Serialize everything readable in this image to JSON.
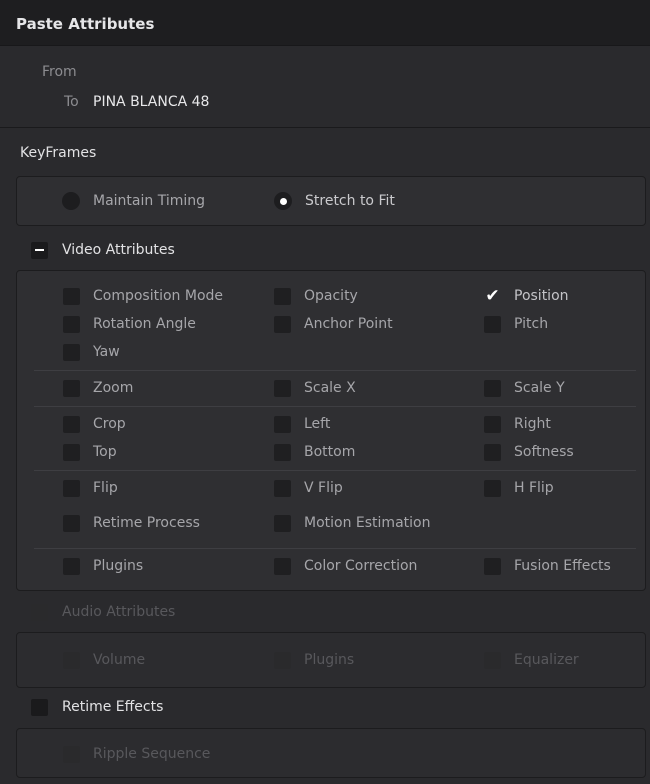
{
  "dialog": {
    "title": "Paste Attributes",
    "from_label": "From",
    "to_label": "To",
    "to_value": "PINA BLANCA 48"
  },
  "keyframes": {
    "title": "KeyFrames",
    "options": [
      {
        "label": "Maintain Timing",
        "selected": false
      },
      {
        "label": "Stretch to Fit",
        "selected": true
      }
    ]
  },
  "video_attributes": {
    "title": "Video Attributes",
    "state": "partial",
    "items": {
      "composition_mode": {
        "label": "Composition Mode",
        "checked": false
      },
      "opacity": {
        "label": "Opacity",
        "checked": false
      },
      "position": {
        "label": "Position",
        "checked": true
      },
      "rotation_angle": {
        "label": "Rotation Angle",
        "checked": false
      },
      "anchor_point": {
        "label": "Anchor Point",
        "checked": false
      },
      "pitch": {
        "label": "Pitch",
        "checked": false
      },
      "yaw": {
        "label": "Yaw",
        "checked": false
      },
      "zoom": {
        "label": "Zoom",
        "checked": false
      },
      "scale_x": {
        "label": "Scale X",
        "checked": false
      },
      "scale_y": {
        "label": "Scale Y",
        "checked": false
      },
      "crop": {
        "label": "Crop",
        "checked": false
      },
      "left": {
        "label": "Left",
        "checked": false
      },
      "right": {
        "label": "Right",
        "checked": false
      },
      "top": {
        "label": "Top",
        "checked": false
      },
      "bottom": {
        "label": "Bottom",
        "checked": false
      },
      "softness": {
        "label": "Softness",
        "checked": false
      },
      "flip": {
        "label": "Flip",
        "checked": false
      },
      "v_flip": {
        "label": "V Flip",
        "checked": false
      },
      "h_flip": {
        "label": "H Flip",
        "checked": false
      },
      "retime_process": {
        "label": "Retime Process",
        "checked": false
      },
      "motion_estimation": {
        "label": "Motion Estimation",
        "checked": false
      },
      "plugins": {
        "label": "Plugins",
        "checked": false
      },
      "color_correction": {
        "label": "Color Correction",
        "checked": false
      },
      "fusion_effects": {
        "label": "Fusion Effects",
        "checked": false
      }
    }
  },
  "audio_attributes": {
    "title": "Audio Attributes",
    "enabled": false,
    "items": {
      "volume": {
        "label": "Volume",
        "checked": false
      },
      "plugins": {
        "label": "Plugins",
        "checked": false
      },
      "equalizer": {
        "label": "Equalizer",
        "checked": false
      }
    }
  },
  "retime_effects": {
    "title": "Retime Effects",
    "checked": false,
    "items": {
      "ripple_sequence": {
        "label": "Ripple Sequence",
        "checked": false
      }
    }
  },
  "colors": {
    "background": "#2a2a2d",
    "title_bar": "#1e1e20",
    "panel": "#2f2f32",
    "checkbox": "#1f1f21",
    "accent_white": "#ffffff"
  }
}
